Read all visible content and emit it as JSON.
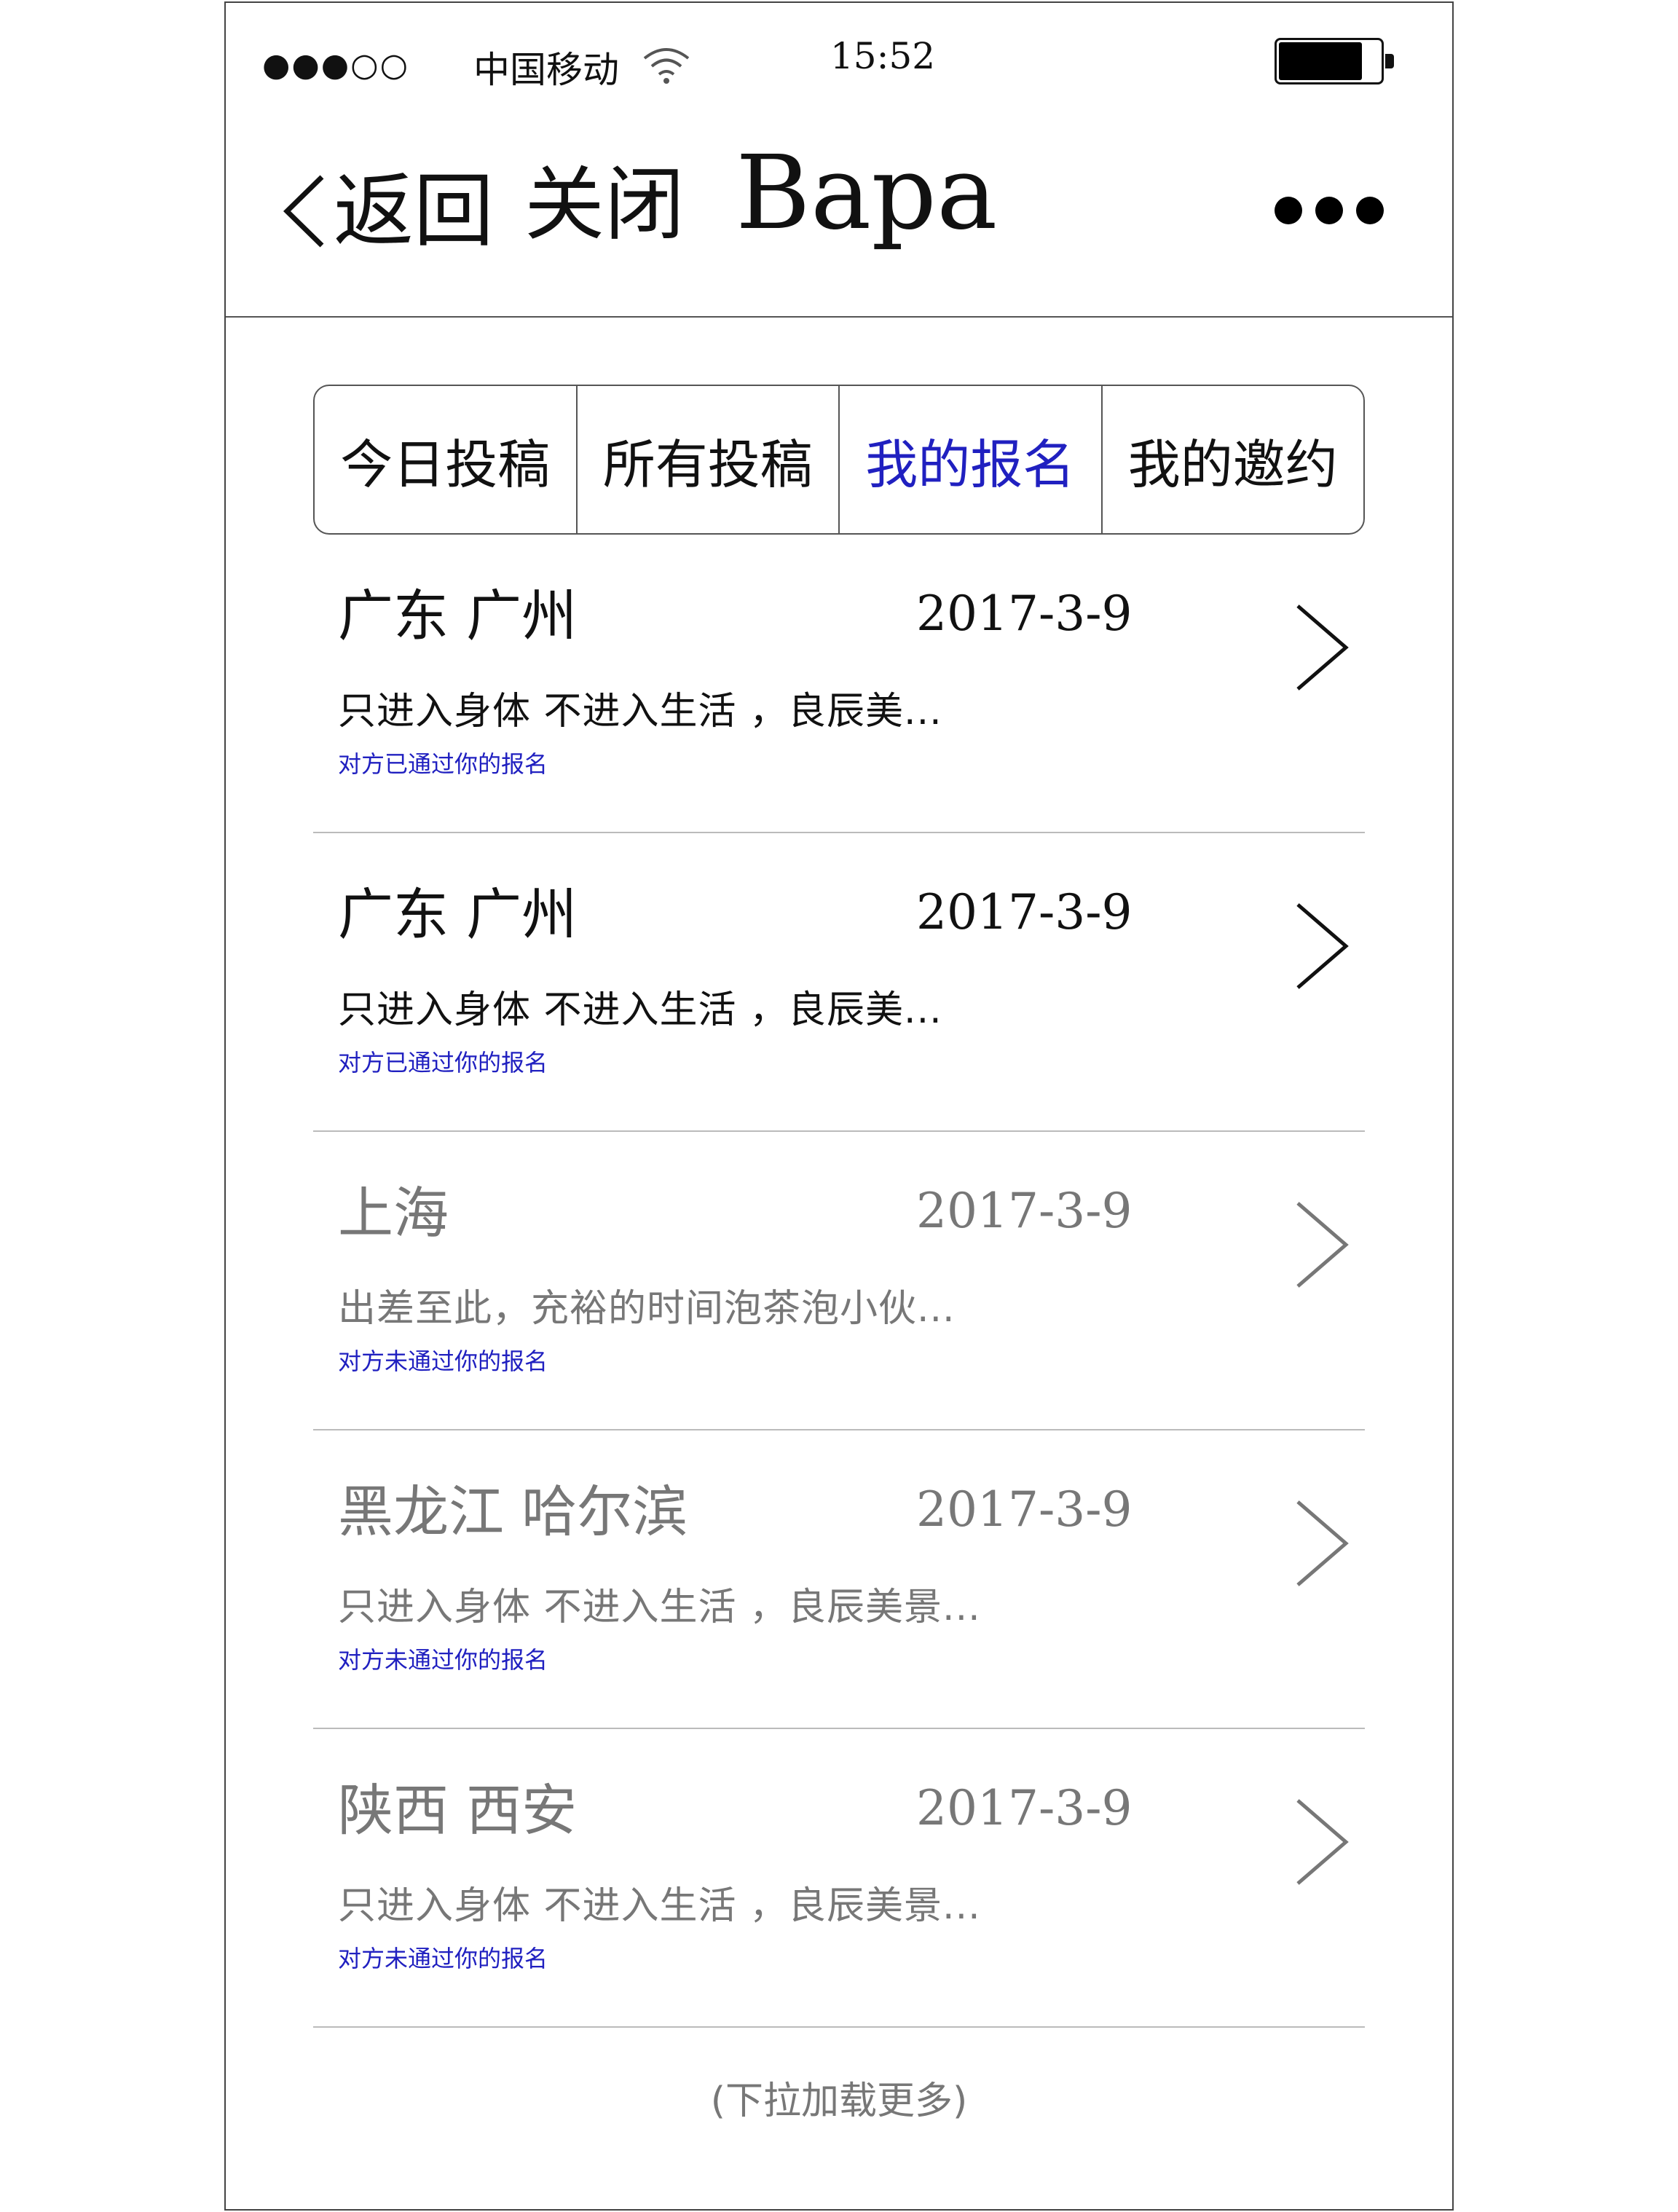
{
  "status_bar": {
    "signal": "●●●○○",
    "carrier": "中国移动",
    "time": "15:52"
  },
  "nav": {
    "back_label": "返回",
    "close_label": "关闭",
    "title": "Bapa"
  },
  "tabs": [
    {
      "label": "今日投稿",
      "active": false
    },
    {
      "label": "所有投稿",
      "active": false
    },
    {
      "label": "我的报名",
      "active": true
    },
    {
      "label": "我的邀约",
      "active": false
    }
  ],
  "items": [
    {
      "location": "广东  广州",
      "date": "2017-3-9",
      "desc": "只进入身体 不进入生活 ，良辰美...",
      "status": "对方已通过你的报名",
      "dim": false
    },
    {
      "location": "广东  广州",
      "date": "2017-3-9",
      "desc": "只进入身体 不进入生活 ，良辰美...",
      "status": "对方已通过你的报名",
      "dim": false
    },
    {
      "location": "上海",
      "date": "2017-3-9",
      "desc": "出差至此，充裕的时间泡茶泡小伙...",
      "status": "对方未通过你的报名",
      "dim": true
    },
    {
      "location": "黑龙江  哈尔滨",
      "date": "2017-3-9",
      "desc": "只进入身体 不进入生活 ，良辰美景...",
      "status": "对方未通过你的报名",
      "dim": true
    },
    {
      "location": "陕西  西安",
      "date": "2017-3-9",
      "desc": "只进入身体 不进入生活 ，良辰美景...",
      "status": "对方未通过你的报名",
      "dim": true
    }
  ],
  "load_more": "(下拉加载更多)",
  "colors": {
    "accent": "#2020c0",
    "dim_text": "#777777",
    "border": "#555555"
  }
}
